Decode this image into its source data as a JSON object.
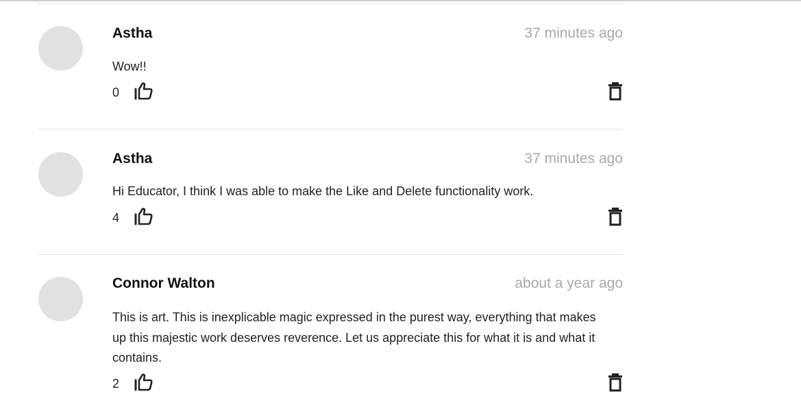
{
  "comments": [
    {
      "author": "Astha",
      "timestamp": "37 minutes ago",
      "text": "Wow!!",
      "likes": "0",
      "like_icon": "thumbs-up-icon",
      "delete_icon": "trash-icon"
    },
    {
      "author": "Astha",
      "timestamp": "37 minutes ago",
      "text": "Hi Educator, I think I was able to make the Like and Delete functionality work.",
      "likes": "4",
      "like_icon": "thumbs-up-icon",
      "delete_icon": "trash-icon"
    },
    {
      "author": "Connor Walton",
      "timestamp": "about a year ago",
      "text": "This is art. This is inexplicable magic expressed in the purest way, everything that makes up this majestic work deserves reverence. Let us appreciate this for what it is and what it contains.",
      "likes": "2",
      "like_icon": "thumbs-up-icon",
      "delete_icon": "trash-icon"
    }
  ],
  "colors": {
    "avatar_placeholder": "#e1e1e1",
    "timestamp": "#a9a9a9",
    "divider": "#e6e6e6",
    "text": "#222222"
  }
}
